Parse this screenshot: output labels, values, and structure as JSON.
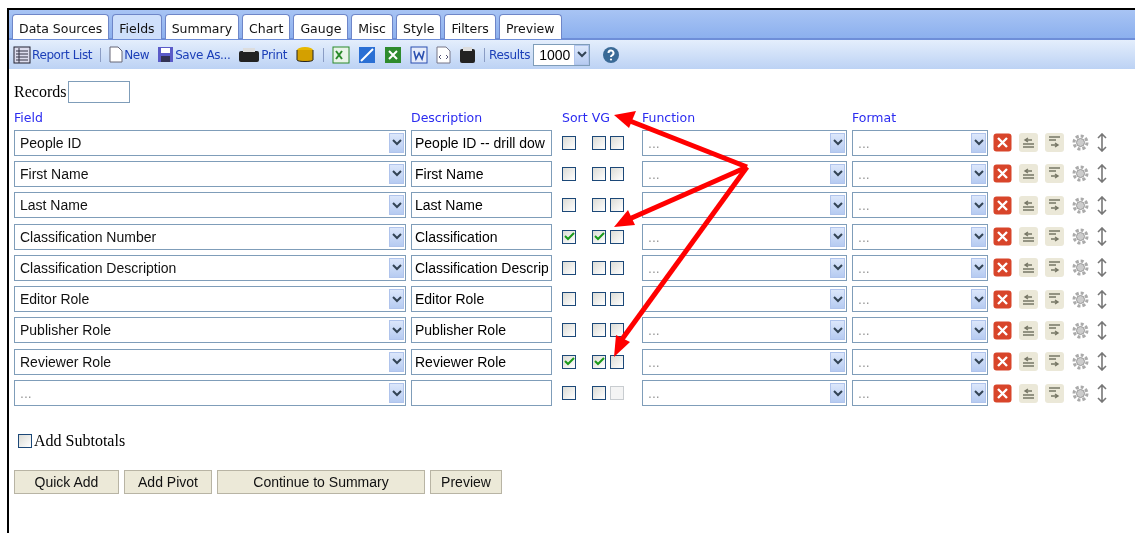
{
  "tabs": [
    {
      "label": "Data Sources",
      "selected": false
    },
    {
      "label": "Fields",
      "selected": true
    },
    {
      "label": "Summary",
      "selected": false
    },
    {
      "label": "Chart",
      "selected": false
    },
    {
      "label": "Gauge",
      "selected": false
    },
    {
      "label": "Misc",
      "selected": false
    },
    {
      "label": "Style",
      "selected": false
    },
    {
      "label": "Filters",
      "selected": false
    },
    {
      "label": "Preview",
      "selected": false
    }
  ],
  "toolbar": {
    "report_list": "Report List",
    "new": "New",
    "save_as": "Save As...",
    "print": "Print",
    "results_label": "Results",
    "results_value": "1000"
  },
  "records": {
    "label": "Records"
  },
  "columns": {
    "field": "Field",
    "description": "Description",
    "sort": "Sort",
    "vg": "VG",
    "function": "Function",
    "format": "Format"
  },
  "rows": [
    {
      "field": {
        "value": "People ID"
      },
      "description": "People ID -- drill dow",
      "sort_checked": false,
      "vg_checked": false,
      "column_3": {
        "checked": false,
        "disabled": false
      },
      "function": {
        "placeholder": "..."
      },
      "format": {
        "placeholder": "..."
      }
    },
    {
      "field": {
        "value": "First Name"
      },
      "description": "First Name",
      "sort_checked": false,
      "vg_checked": false,
      "column_3": {
        "checked": false,
        "disabled": false
      },
      "function": {
        "placeholder": "..."
      },
      "format": {
        "placeholder": "..."
      }
    },
    {
      "field": {
        "value": "Last Name"
      },
      "description": "Last Name",
      "sort_checked": false,
      "vg_checked": false,
      "column_3": {
        "checked": false,
        "disabled": false
      },
      "function": {},
      "format": {
        "placeholder": "..."
      }
    },
    {
      "field": {
        "value": "Classification Number"
      },
      "description": "Classification",
      "sort_checked": true,
      "vg_checked": true,
      "column_3": {
        "checked": false,
        "disabled": false
      },
      "function": {
        "placeholder": "..."
      },
      "format": {
        "placeholder": "..."
      }
    },
    {
      "field": {
        "value": "Classification Description"
      },
      "description": "Classification Descrip",
      "sort_checked": false,
      "vg_checked": false,
      "column_3": {
        "checked": false,
        "disabled": false
      },
      "function": {
        "placeholder": "..."
      },
      "format": {
        "placeholder": "..."
      }
    },
    {
      "field": {
        "value": "Editor Role"
      },
      "description": "Editor Role",
      "sort_checked": false,
      "vg_checked": false,
      "column_3": {
        "checked": false,
        "disabled": false
      },
      "function": {},
      "format": {
        "placeholder": "..."
      }
    },
    {
      "field": {
        "value": "Publisher Role"
      },
      "description": "Publisher Role",
      "sort_checked": false,
      "vg_checked": false,
      "column_3": {
        "checked": false,
        "disabled": false
      },
      "function": {
        "placeholder": "..."
      },
      "format": {
        "placeholder": "..."
      }
    },
    {
      "field": {
        "value": "Reviewer Role"
      },
      "description": "Reviewer Role",
      "sort_checked": true,
      "vg_checked": true,
      "column_3": {
        "checked": false,
        "disabled": false
      },
      "function": {
        "placeholder": "..."
      },
      "format": {
        "placeholder": "..."
      }
    },
    {
      "field": {
        "placeholder": "..."
      },
      "description": "",
      "sort_checked": false,
      "vg_checked": false,
      "column_3": {
        "checked": false,
        "disabled": true
      },
      "function": {
        "placeholder": "..."
      },
      "format": {
        "placeholder": "..."
      }
    }
  ],
  "add_subtotals": {
    "label": "Add Subtotals",
    "checked": false
  },
  "buttons": [
    "Quick Add",
    "Add Pivot",
    "Continue to Summary",
    "Preview"
  ]
}
